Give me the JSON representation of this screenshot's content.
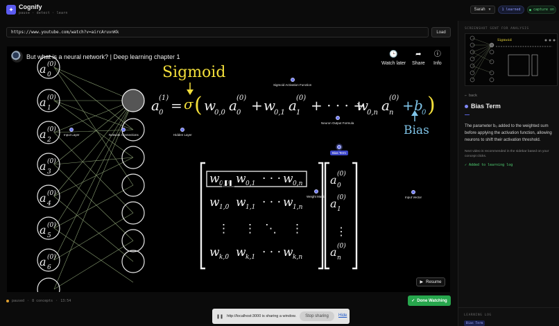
{
  "app": {
    "brand": "Cognify",
    "subtitle": "pause · detect · learn",
    "logo_icon": "sparkle-icon"
  },
  "header": {
    "user_name": "Sarah",
    "learned_label": "1 learned",
    "capture_label": "capture on"
  },
  "url_bar": {
    "value": "https://www.youtube.com/watch?v=aircAruvnKk",
    "load_label": "Load"
  },
  "video": {
    "title": "But what is a neural network? | Deep learning chapter 1",
    "controls": [
      {
        "label": "Watch later",
        "icon": "clock-icon"
      },
      {
        "label": "Share",
        "icon": "share-icon"
      },
      {
        "label": "Info",
        "icon": "info-icon"
      }
    ],
    "frame": {
      "heading": "Sigmoid",
      "bias_label": "Bias",
      "layer_nodes": [
        "a0(0)",
        "a1(0)",
        "a2(0)",
        "a3(0)",
        "a4(0)",
        "a5(0)",
        "a6(0)",
        "a7(0)"
      ]
    },
    "hotspots": {
      "sigmoid": "Sigmoid Activation Function",
      "input_layer": "Input Layer",
      "network_connections": "Network Connections",
      "hidden_layer": "Hidden Layer",
      "neuron_output": "Neuron Output Formula",
      "bias_term": "Bias Term",
      "weight_matrix": "Weight Matrix",
      "input_vector": "Input Vector"
    },
    "resume_label": "Resume"
  },
  "status": {
    "state": "paused",
    "concepts": "8 concepts",
    "time": "13:54"
  },
  "done_label": "Done Watching",
  "share_banner": {
    "text": "http://localhost:3000 is sharing a window.",
    "stop_label": "Stop sharing",
    "hide_label": "Hide"
  },
  "panel": {
    "caption": "SCREENSHOT SENT FOR ANALYSIS",
    "back_label": "← back",
    "concept_title": "Bias Term",
    "description": "The parameter b₀ added to the weighted sum before applying the activation function, allowing neurons to shift their activation threshold.",
    "note": "Next video is recommended in the sidebar based on your concept clicks.",
    "added_label": "✓ Added to learning log",
    "log_caption": "LEARNING LOG",
    "log_items": [
      "Bias Term"
    ]
  },
  "colors": {
    "accent": "#6f7bf2",
    "success": "#27a64d",
    "paused_dot": "#e0a030"
  }
}
